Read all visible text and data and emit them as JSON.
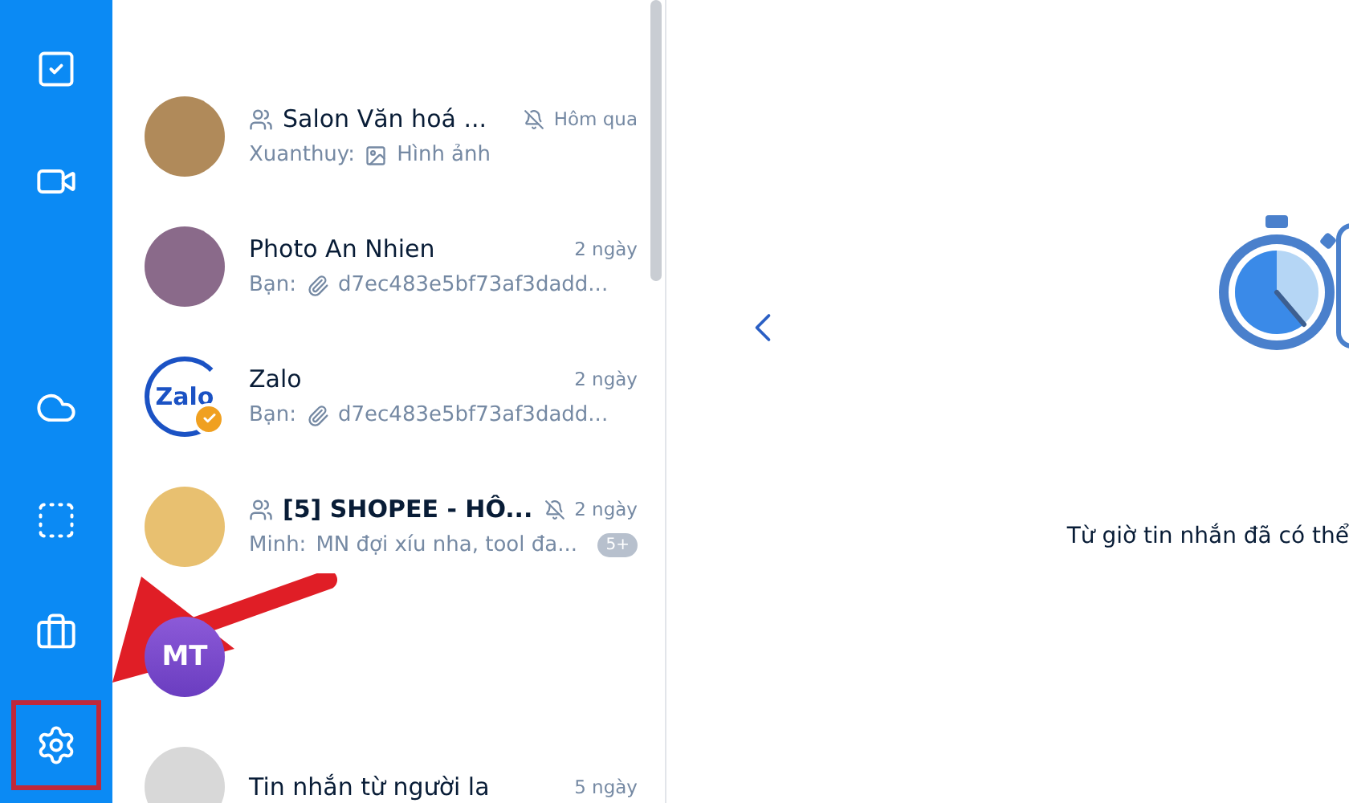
{
  "sidebar": {
    "top_items": [
      {
        "kind": "todo",
        "highlighted": false
      },
      {
        "kind": "video",
        "highlighted": false
      }
    ],
    "bottom_items": [
      {
        "kind": "cloud",
        "highlighted": false
      },
      {
        "kind": "capture",
        "highlighted": false
      },
      {
        "kind": "toolbox",
        "highlighted": false
      },
      {
        "kind": "settings",
        "highlighted": true
      }
    ]
  },
  "conversations": [
    {
      "name": "Salon Văn hoá ...",
      "group": true,
      "muted": true,
      "time": "Hôm qua",
      "message": {
        "kind": "image",
        "sender": "Xuanthuy:",
        "text": "Hình ảnh"
      },
      "avatar": {
        "kind": "photo",
        "color": "#b08a5a"
      }
    },
    {
      "name": "Photo An Nhien",
      "group": false,
      "muted": false,
      "time": "2 ngày",
      "message": {
        "kind": "attachment",
        "sender": "Bạn:",
        "text": "d7ec483e5bf73af3dadd..."
      },
      "avatar": {
        "kind": "photo",
        "color": "#8a6a8a"
      }
    },
    {
      "name": "Zalo",
      "group": false,
      "muted": false,
      "time": "2 ngày",
      "message": {
        "kind": "attachment",
        "sender": "Bạn:",
        "text": "d7ec483e5bf73af3dadd..."
      },
      "avatar": {
        "kind": "logo",
        "text": "Zalo",
        "verified": true
      }
    },
    {
      "name": "[5] SHOPEE - HÔ...",
      "group": true,
      "muted": true,
      "time": "2 ngày",
      "message": {
        "kind": "text",
        "sender": "Minh:",
        "text": "MN đợi xíu nha, tool đa..."
      },
      "badge": "5+",
      "bold": true,
      "avatar": {
        "kind": "photo",
        "color": "#e8c070"
      }
    },
    {
      "avatar": {
        "kind": "initials",
        "text": "MT"
      }
    },
    {
      "name": "Tin nhắn từ người la",
      "group": false,
      "muted": false,
      "time": "5 ngày",
      "avatar": {
        "kind": "photo",
        "color": "#d8d8d8"
      }
    }
  ],
  "main": {
    "caption": "Từ giờ tin nhắn đã có thể"
  },
  "annotation": {
    "arrow": true
  }
}
